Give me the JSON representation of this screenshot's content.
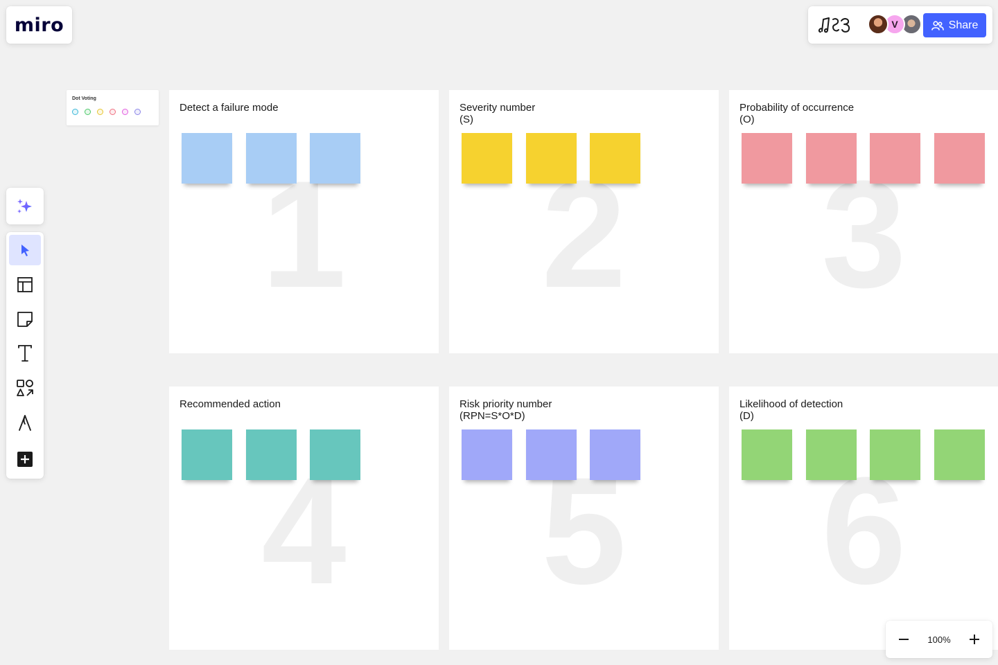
{
  "app": {
    "logo_text": "miro"
  },
  "header": {
    "board_icon": "music-notes-board-icon",
    "avatars": [
      {
        "name": "avatar-1",
        "initial": ""
      },
      {
        "name": "avatar-2",
        "initial": "V"
      },
      {
        "name": "avatar-3",
        "initial": ""
      }
    ],
    "share_label": "Share",
    "share_icon": "users-icon",
    "accent_color": "#4262ff"
  },
  "dot_voting": {
    "title": "Dot Voting",
    "dot_colors": [
      "#3bb8d9",
      "#4dc96a",
      "#e6c52e",
      "#f06f80",
      "#e25ee0",
      "#8a84e8"
    ]
  },
  "toolbar": {
    "ai_icon": "sparkles-icon",
    "tools": [
      {
        "name": "select-tool",
        "icon": "cursor-icon",
        "active": true
      },
      {
        "name": "templates-tool",
        "icon": "layout-icon",
        "active": false
      },
      {
        "name": "sticky-note-tool",
        "icon": "sticky-note-icon",
        "active": false
      },
      {
        "name": "text-tool",
        "icon": "text-icon",
        "active": false
      },
      {
        "name": "shapes-tool",
        "icon": "shapes-icon",
        "active": false
      },
      {
        "name": "pen-tool",
        "icon": "pen-icon",
        "active": false
      },
      {
        "name": "more-tools",
        "icon": "plus-square-icon",
        "active": false
      }
    ]
  },
  "frames": [
    {
      "title": "Detect a failure mode",
      "number": "1",
      "sticky_color": "#a8cdf5",
      "sticky_count": 3
    },
    {
      "title": "Severity number\n(S)",
      "number": "2",
      "sticky_color": "#f6d22f",
      "sticky_count": 3
    },
    {
      "title": "Probability of occurrence\n(O)",
      "number": "3",
      "sticky_color": "#f0999f",
      "sticky_count": 4
    },
    {
      "title": "Recommended action",
      "number": "4",
      "sticky_color": "#67c6bd",
      "sticky_count": 3
    },
    {
      "title": "Risk priority number\n(RPN=S*O*D)",
      "number": "5",
      "sticky_color": "#a0a8f9",
      "sticky_count": 3
    },
    {
      "title": "Likelihood of detection\n(D)",
      "number": "6",
      "sticky_color": "#93d576",
      "sticky_count": 4
    }
  ],
  "zoom": {
    "value": "100%",
    "zoom_out_icon": "minus-icon",
    "zoom_in_icon": "plus-icon"
  }
}
